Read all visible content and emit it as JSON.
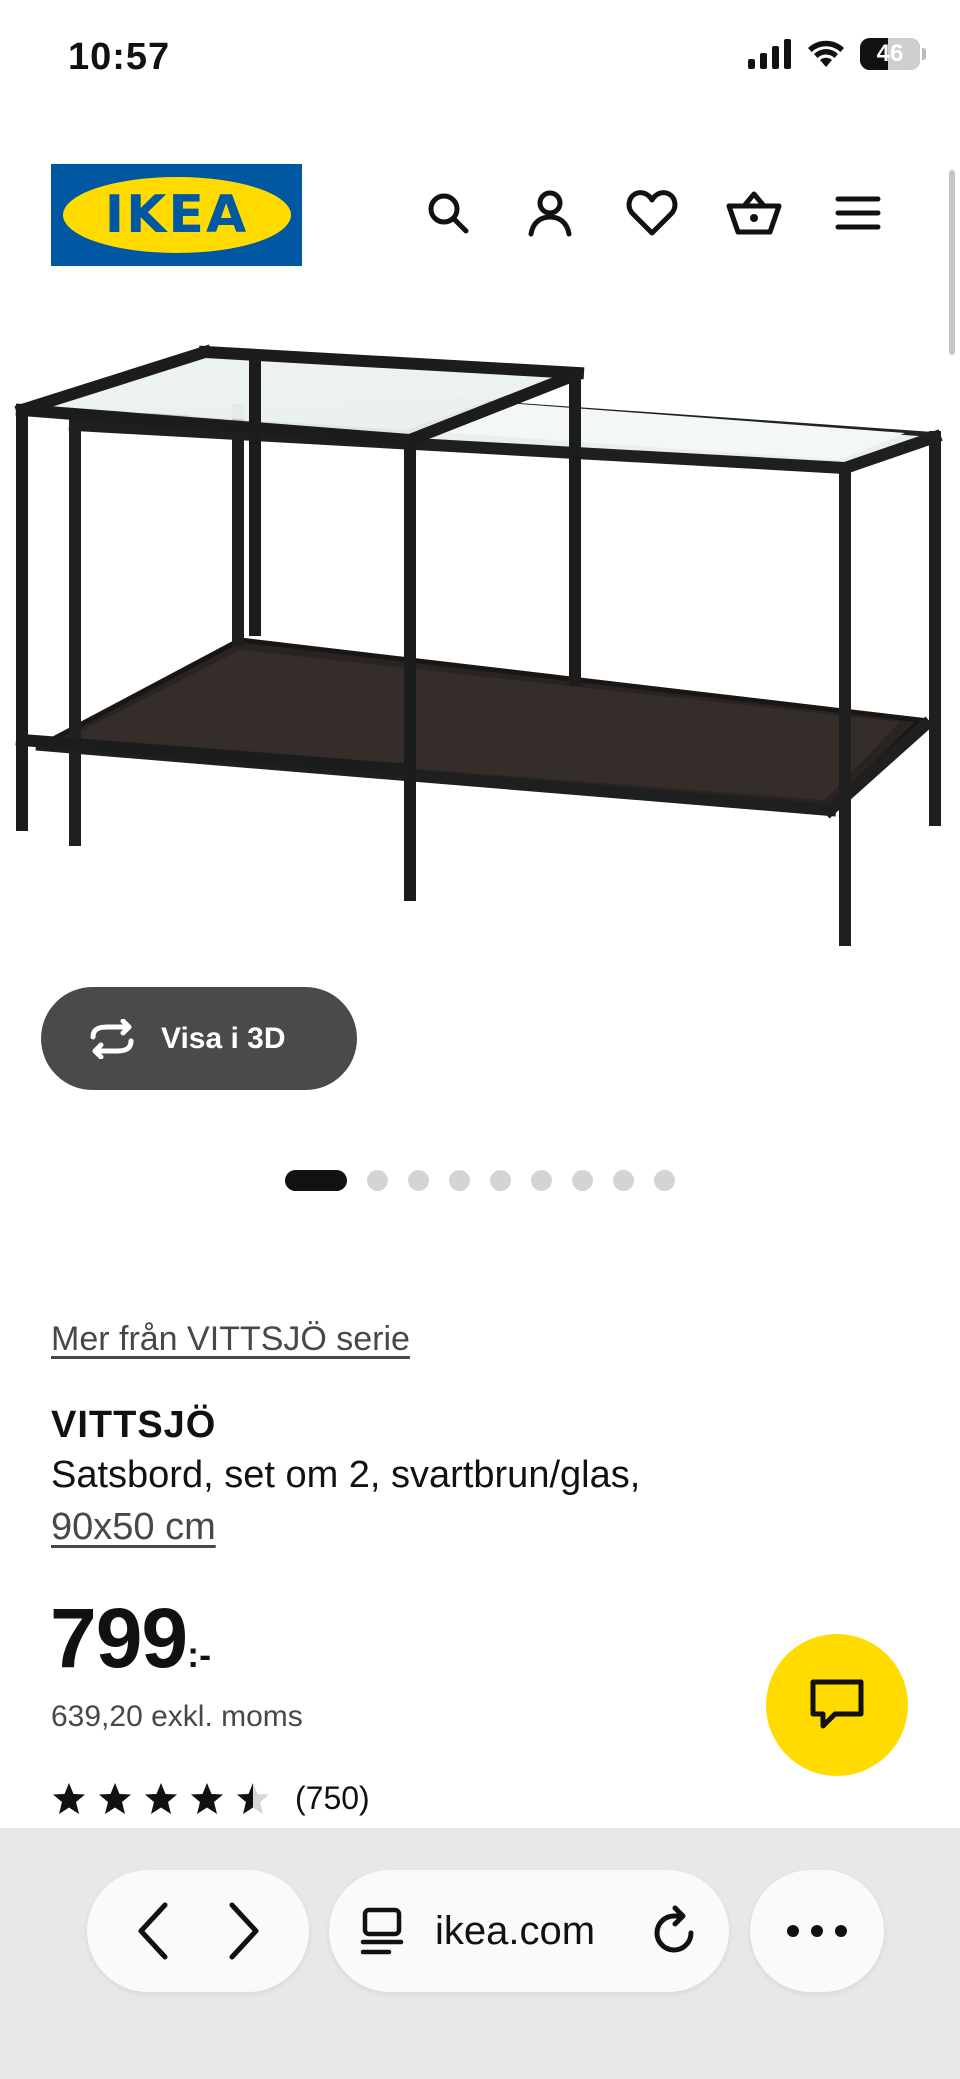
{
  "status_bar": {
    "time": "10:57",
    "battery_level": "46",
    "battery_fraction": 0.46
  },
  "header": {
    "logo_text": "IKEA",
    "icons": [
      "search-icon",
      "profile-icon",
      "heart-icon",
      "basket-icon",
      "menu-icon"
    ]
  },
  "gallery": {
    "view_3d_label": "Visa i 3D",
    "image_count": 9,
    "active_index": 0
  },
  "product": {
    "series_link": "Mer från VITTSJÖ serie",
    "name": "VITTSJÖ",
    "description": "Satsbord, set om 2, svartbrun/glas,",
    "size": "90x50 cm",
    "price": "799",
    "price_suffix": ":-",
    "price_excl_vat": "639,20 exkl. moms",
    "rating_value": 4.5,
    "rating_max": 5,
    "review_count": "(750)"
  },
  "browser": {
    "url": "ikea.com"
  },
  "colors": {
    "ikea_blue": "#0058a3",
    "ikea_yellow": "#ffdb00",
    "dark_button": "#4a4a4a"
  }
}
